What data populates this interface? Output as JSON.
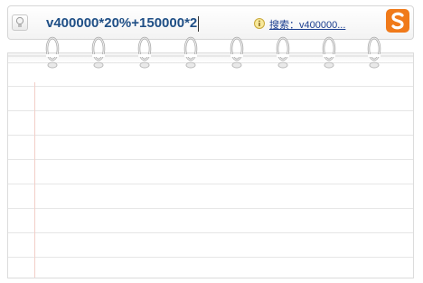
{
  "search_bar": {
    "input_value": "v400000*20%+150000*2",
    "search_link_text": "搜索：v400000...",
    "bulb_icon": "lightbulb-icon",
    "info_icon": "info-icon",
    "logo_icon": "sogou-s-logo"
  },
  "colors": {
    "input_text": "#1f4f86",
    "logo_orange": "#f07a1a",
    "link": "#1a3d8f"
  }
}
